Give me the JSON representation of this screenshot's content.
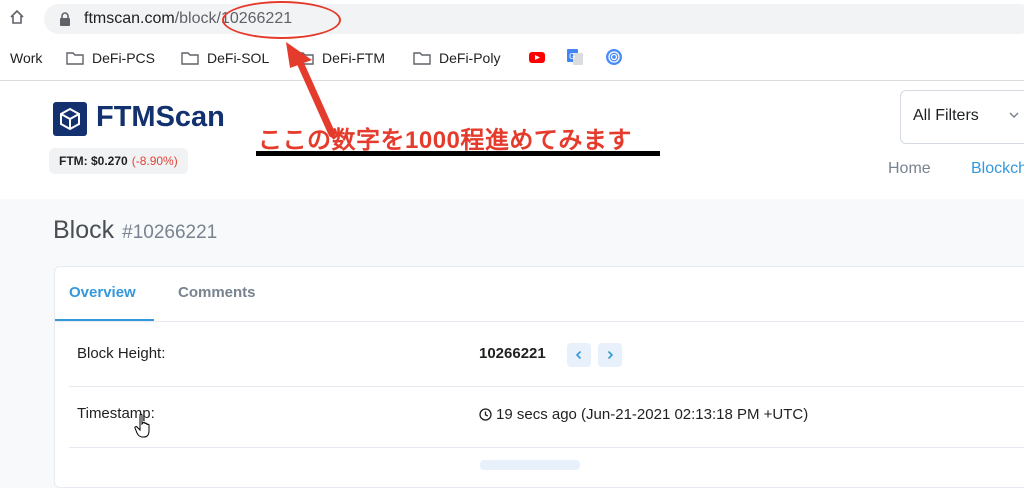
{
  "browser": {
    "url_host": "ftmscan.com",
    "url_path": "/block/10266221",
    "bookmarks": [
      {
        "label": "Work",
        "type": "text"
      },
      {
        "label": "DeFi-PCS",
        "type": "folder"
      },
      {
        "label": "DeFi-SOL",
        "type": "folder"
      },
      {
        "label": "DeFi-FTM",
        "type": "folder"
      },
      {
        "label": "DeFi-Poly",
        "type": "folder"
      }
    ],
    "bookmark_icons": [
      "youtube-icon",
      "google-translate-icon",
      "fingerprint-icon"
    ]
  },
  "header": {
    "logo_text": "FTMScan",
    "price_label": "FTM: $0.270",
    "price_change": "(-8.90%)",
    "filter_label": "All Filters",
    "nav": [
      {
        "label": "Home"
      },
      {
        "label": "Blockch"
      }
    ]
  },
  "annotation": {
    "note": "ここの数字を1000程進めてみます",
    "color": "#e53b2c"
  },
  "page": {
    "title": "Block",
    "block_hash_label": "#10266221",
    "tabs": [
      {
        "label": "Overview",
        "active": true
      },
      {
        "label": "Comments",
        "active": false
      }
    ],
    "rows": [
      {
        "label": "Block Height:",
        "value": "10266221"
      },
      {
        "label": "Timestamp:",
        "value": "19 secs ago (Jun-21-2021 02:13:18 PM +UTC)"
      }
    ]
  },
  "colors": {
    "brand": "#13316e",
    "accent": "#3498db",
    "negative": "#de4437"
  }
}
